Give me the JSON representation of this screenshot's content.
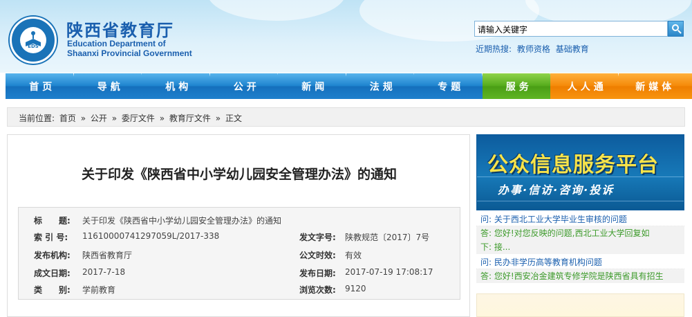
{
  "header": {
    "logo_cn": "陕西省教育厅",
    "logo_en_line1": "Education Department of",
    "logo_en_line2": "Shaanxi Provincial Government",
    "emblem_text": "EDS",
    "search_value": "请输入关键字",
    "hot_label": "近期热搜:",
    "hot_items": [
      "教师资格",
      "基础教育"
    ]
  },
  "nav": {
    "items": [
      "首页",
      "导航",
      "机构",
      "公开",
      "新闻",
      "法规",
      "专题",
      "服务",
      "人人通",
      "新媒体"
    ],
    "colors": {
      "blue": "#1f84cf",
      "green": "#56ac1d",
      "orange": "#f58a0a"
    }
  },
  "breadcrumb": {
    "label": "当前位置:",
    "items": [
      "首页",
      "»",
      "公开",
      "»",
      "委厅文件",
      "»",
      "教育厅文件",
      "»",
      "正文"
    ]
  },
  "article": {
    "title": "关于印发《陕西省中小学幼儿园安全管理办法》的通知",
    "meta": {
      "title_label": "标　　题:",
      "title_value": "关于印发《陕西省中小学幼儿园安全管理办法》的通知",
      "index_label": "索 引 号:",
      "index_value": "11610000741297059L/2017-338",
      "doc_no_label": "发文字号:",
      "doc_no_value": "陕教规范〔2017〕7号",
      "issuer_label": "发布机构:",
      "issuer_value": "陕西省教育厅",
      "validity_label": "公文时效:",
      "validity_value": "有效",
      "date_label": "成文日期:",
      "date_value": "2017-7-18",
      "pub_label": "发布日期:",
      "pub_value": "2017-07-19 17:08:17",
      "category_label": "类　　别:",
      "category_value": "学前教育",
      "views_label": "浏览次数:",
      "views_value": "9120"
    }
  },
  "sidebar": {
    "banner_title": "公众信息服务平台",
    "banner_sub": "办事·信访·咨询·投诉",
    "qa": [
      {
        "type": "q",
        "text": "问: 关于西北工业大学毕业生审核的问题"
      },
      {
        "type": "a",
        "text": "答: 您好!对您反映的问题,西北工业大学回复如"
      },
      {
        "type": "a",
        "text": "下: 接..."
      },
      {
        "type": "q",
        "text": "问: 民办非学历高等教育机构问题"
      },
      {
        "type": "a",
        "text": "答: 您好!西安冶金建筑专修学院是陕西省具有招生"
      }
    ]
  }
}
